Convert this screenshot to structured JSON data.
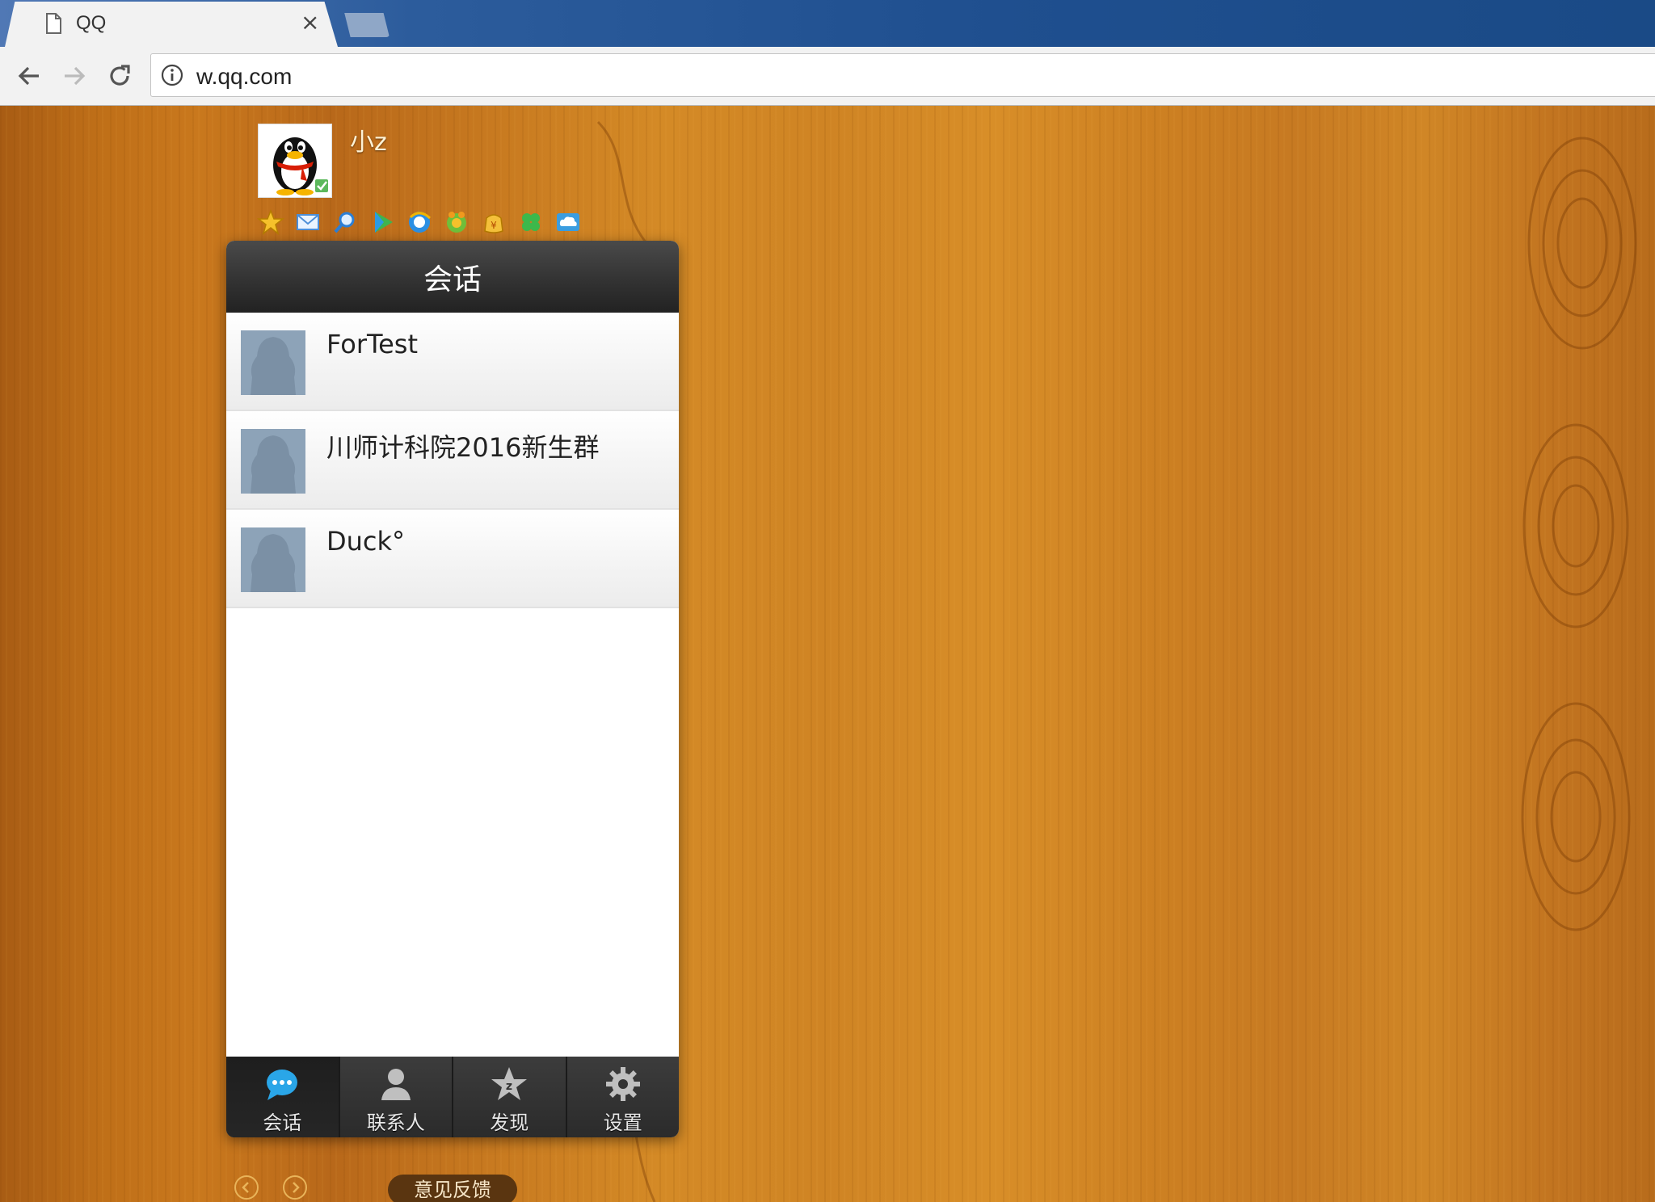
{
  "browser": {
    "tab_title": "QQ",
    "close_symbol": "×",
    "url": "w.qq.com"
  },
  "user": {
    "nickname": "小z"
  },
  "app_icons": [
    "star-icon",
    "mail-icon",
    "search-icon",
    "video-play-icon",
    "browser-icon",
    "game-icon",
    "wallet-icon",
    "clover-icon",
    "cloud-icon"
  ],
  "panel": {
    "title": "会话",
    "conversations": [
      {
        "name": "ForTest"
      },
      {
        "name": "川师计科院2016新生群"
      },
      {
        "name": "Duck°"
      }
    ],
    "nav": [
      {
        "label": "会话",
        "icon": "chat-icon",
        "active": true
      },
      {
        "label": "联系人",
        "icon": "contact-icon",
        "active": false
      },
      {
        "label": "发现",
        "icon": "discover-icon",
        "active": false
      },
      {
        "label": "设置",
        "icon": "gear-icon",
        "active": false
      }
    ]
  },
  "footer": {
    "feedback_label": "意见反馈"
  },
  "colors": {
    "header_dark": "#333333",
    "wood": "#c87a20",
    "chat_blue": "#2aa6e8"
  }
}
